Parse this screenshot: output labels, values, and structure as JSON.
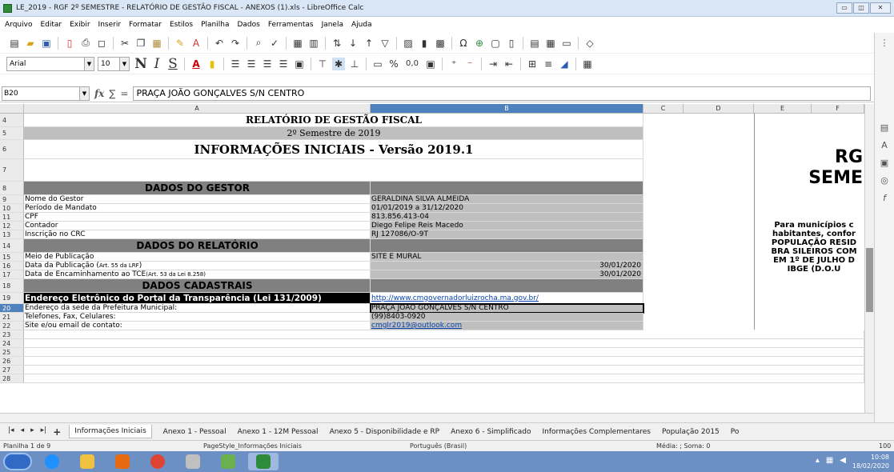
{
  "window": {
    "title": "LE_2019 - RGF 2º SEMESTRE - RELATÓRIO DE GESTÃO FISCAL - ANEXOS (1).xls - LibreOffice Calc"
  },
  "menu": [
    "Arquivo",
    "Editar",
    "Exibir",
    "Inserir",
    "Formatar",
    "Estilos",
    "Planilha",
    "Dados",
    "Ferramentas",
    "Janela",
    "Ajuda"
  ],
  "toolbar": {
    "font_name": "Arial",
    "font_size": "10",
    "bold": "N",
    "italic": "I",
    "underline": "S",
    "percent": "%",
    "decimal": "0,0"
  },
  "formula": {
    "cell_ref": "B20",
    "fx": "fx",
    "sigma": "∑",
    "equals": "=",
    "content": "PRAÇA JOÃO GONÇALVES S/N CENTRO"
  },
  "columns": [
    "A",
    "B",
    "C",
    "D",
    "E",
    "F"
  ],
  "rows": {
    "r4": {
      "num": "4",
      "text": "RELATÓRIO DE GESTÃO FISCAL"
    },
    "r5": {
      "num": "5",
      "text": "2º Semestre de 2019"
    },
    "r6": {
      "num": "6",
      "text": "INFORMAÇÕES INICIAIS - Versão 2019.1"
    },
    "r7": {
      "num": "7"
    },
    "r8": {
      "num": "8",
      "text": "DADOS DO GESTOR"
    },
    "r9": {
      "num": "9",
      "a": "Nome do Gestor",
      "b": "GERALDINA SILVA ALMEIDA"
    },
    "r10": {
      "num": "10",
      "a": "Período de Mandato",
      "b": "01/01/2019 a 31/12/2020"
    },
    "r11": {
      "num": "11",
      "a": "CPF",
      "b": "813.856.413-04"
    },
    "r12": {
      "num": "12",
      "a": "Contador",
      "b": "Diego Felipe Reis Macedo"
    },
    "r13": {
      "num": "13",
      "a": "Inscrição no CRC",
      "b": "RJ 127086/O-9T"
    },
    "r14": {
      "num": "14",
      "text": "DADOS DO RELATÓRIO"
    },
    "r15": {
      "num": "15",
      "a": "Meio de Publicação",
      "b": "SITE E MURAL"
    },
    "r16": {
      "num": "16",
      "a": "Data da Publicação (",
      "a_small": "Art. 55 da LRF",
      "a_end": ")",
      "b": "30/01/2020"
    },
    "r17": {
      "num": "17",
      "a": "Data de Encaminhamento ao TCE ",
      "a_small": "(Art. 53 da Lei 8.258)",
      "b": "30/01/2020"
    },
    "r18": {
      "num": "18",
      "text": "DADOS CADASTRAIS"
    },
    "r19": {
      "num": "19",
      "a": "Endereço Eletrônico do Portal da Transparência (Lei 131/2009)",
      "b": "http://www.cmgovernadorluizrocha.ma.gov.br/"
    },
    "r20": {
      "num": "20",
      "a": "Endereço da sede da Prefeitura Municipal:",
      "b": "PRAÇA JOÃO GONÇALVES S/N CENTRO"
    },
    "r21": {
      "num": "21",
      "a": "Telefones, Fax, Celulares:",
      "b": "(99)8403-0920"
    },
    "r22": {
      "num": "22",
      "a": "Site e/ou email de contato:",
      "b": "cmglr2019@outlook.com"
    },
    "r23": {
      "num": "23"
    },
    "r24": {
      "num": "24"
    },
    "r25": {
      "num": "25"
    },
    "r26": {
      "num": "26"
    },
    "r27": {
      "num": "27"
    },
    "r28": {
      "num": "28"
    }
  },
  "side_panel": {
    "title1": "RG",
    "title2": "SEME",
    "lines": [
      "Para municípios c",
      "habitantes, confor",
      "POPULAÇÃO RESID",
      "BRA SILEIROS COM",
      "EM 1º DE JULHO D",
      "IBGE (D.O.U"
    ]
  },
  "tabs": {
    "t1": "Informações Iniciais",
    "t2": "Anexo 1 - Pessoal",
    "t3": "Anexo 1 - 12M Pessoal",
    "t4": "Anexo 5 - Disponibilidade e RP",
    "t5": "Anexo 6 - Simplificado",
    "t6": "Informações Complementares",
    "t7": "População 2015",
    "t8": "Po"
  },
  "status": {
    "sheet": "Planilha 1 de 9",
    "pagestyle": "PageStyle_Informações Iniciais",
    "lang": "Português (Brasil)",
    "sum": "Média: ; Soma: 0",
    "zoom": "100"
  },
  "clock": {
    "time": "10:08",
    "date": "18/02/2020"
  }
}
